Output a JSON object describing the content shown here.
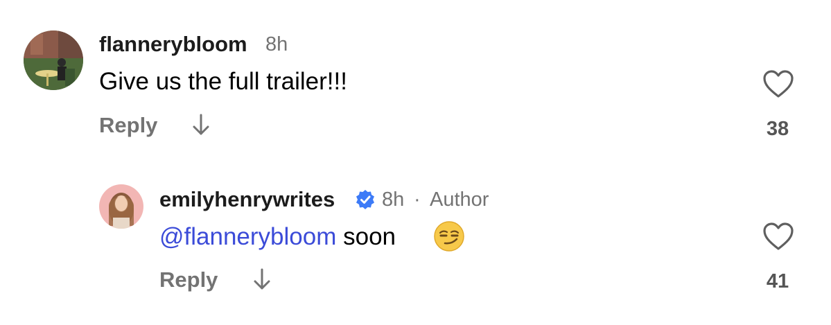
{
  "comments": [
    {
      "username": "flannerybloom",
      "time": "8h",
      "text": "Give us the full trailer!!!",
      "reply_label": "Reply",
      "like_count": "38"
    },
    {
      "username": "emilyhenrywrites",
      "time": "8h",
      "separator": "·",
      "author_badge": "Author",
      "mention": "@flannerybloom",
      "text": " soon",
      "emoji": "smirking-face",
      "reply_label": "Reply",
      "like_count": "41"
    }
  ],
  "icons": {
    "heart": "heart-outline-icon",
    "reply_arrow": "arrow-down-icon",
    "verified": "verified-badge-icon"
  },
  "colors": {
    "mention": "#3b4bd8",
    "verified": "#3d7bf7",
    "secondary_text": "#737373"
  }
}
